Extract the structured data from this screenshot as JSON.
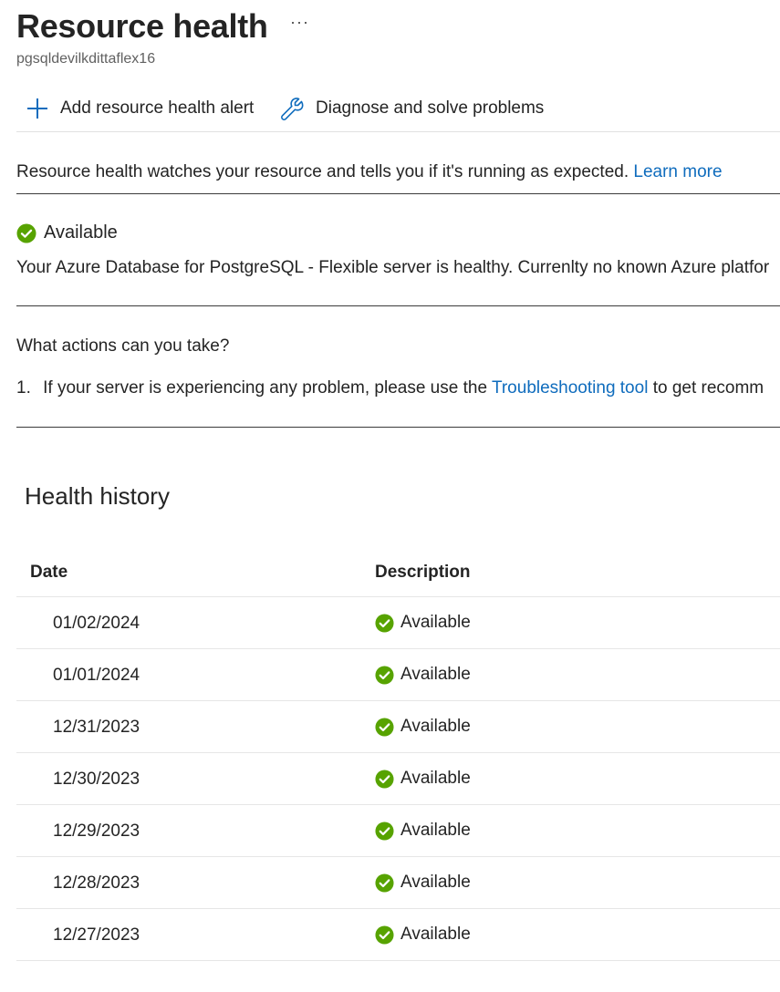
{
  "header": {
    "title": "Resource health",
    "more_label": "···",
    "subtitle": "pgsqldevilkdittaflex16"
  },
  "toolbar": {
    "add_alert_label": "Add resource health alert",
    "add_alert_icon": "plus-icon",
    "diagnose_label": "Diagnose and solve problems",
    "diagnose_icon": "wrench-icon"
  },
  "intro": {
    "text": "Resource health watches your resource and tells you if it's running as expected.",
    "link_label": "Learn more"
  },
  "status": {
    "icon": "check-circle-icon",
    "label": "Available",
    "description": "Your Azure Database for PostgreSQL - Flexible server is healthy. Currenlty no known Azure platfor"
  },
  "actions": {
    "title": "What actions can you take?",
    "item_number": "1.",
    "item_text_before": "If your server is experiencing any problem, please use the",
    "item_link": "Troubleshooting tool",
    "item_text_after": "to get recomm"
  },
  "history": {
    "title": "Health history",
    "columns": [
      "Date",
      "Description"
    ],
    "rows": [
      {
        "date": "01/02/2024",
        "status": "Available"
      },
      {
        "date": "01/01/2024",
        "status": "Available"
      },
      {
        "date": "12/31/2023",
        "status": "Available"
      },
      {
        "date": "12/30/2023",
        "status": "Available"
      },
      {
        "date": "12/29/2023",
        "status": "Available"
      },
      {
        "date": "12/28/2023",
        "status": "Available"
      },
      {
        "date": "12/27/2023",
        "status": "Available"
      }
    ]
  },
  "colors": {
    "link": "#0f6cbd",
    "success": "#57a300",
    "icon_blue": "#0f6cbd"
  }
}
